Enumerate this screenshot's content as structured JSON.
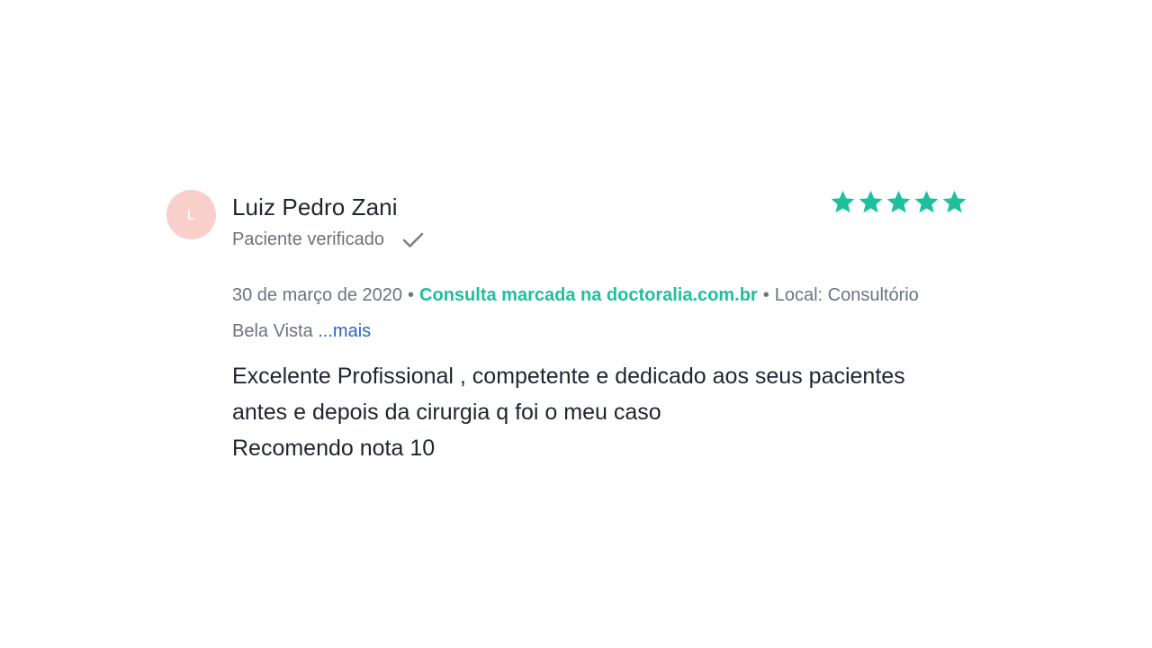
{
  "review": {
    "avatar_initial": "L",
    "author": "Luiz Pedro Zani",
    "verified_label": "Paciente verificado",
    "rating": 5,
    "rating_max": 5,
    "date": "30 de março de 2020",
    "separator": "•",
    "booking_label": "Consulta marcada na doctoralia.com.br",
    "location_prefix": "Local: Consultório",
    "location_suffix": "Bela Vista",
    "more_link": "...mais",
    "text_lines": [
      "Excelente Profissional , competente e dedicado aos seus pacientes",
      "antes e depois da cirurgia q foi o meu caso",
      "Recomendo nota 10"
    ]
  },
  "colors": {
    "star": "#1dbf9e",
    "booking": "#1dbf9e",
    "link": "#2f64c0",
    "avatar_bg": "#f9cfcc"
  },
  "icons": {
    "verified": "check-icon",
    "rating": "star-icon"
  }
}
